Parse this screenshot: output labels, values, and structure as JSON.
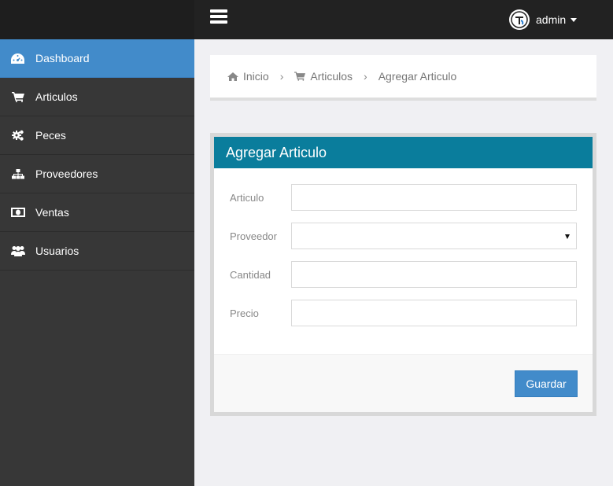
{
  "header": {
    "user_name": "admin",
    "icons": {
      "menu": "hamburger-icon",
      "avatar": "user-avatar-icon",
      "caret": "caret-down-icon"
    }
  },
  "sidebar": {
    "items": [
      {
        "label": "Dashboard",
        "icon": "dashboard-icon",
        "active": true
      },
      {
        "label": "Articulos",
        "icon": "cart-icon",
        "active": false
      },
      {
        "label": "Peces",
        "icon": "cogs-icon",
        "active": false
      },
      {
        "label": "Proveedores",
        "icon": "sitemap-icon",
        "active": false
      },
      {
        "label": "Ventas",
        "icon": "money-icon",
        "active": false
      },
      {
        "label": "Usuarios",
        "icon": "users-icon",
        "active": false
      }
    ]
  },
  "breadcrumb": {
    "home": "Inicio",
    "section": "Articulos",
    "current": "Agregar Articulo"
  },
  "form": {
    "title": "Agregar Articulo",
    "fields": {
      "articulo": {
        "label": "Articulo",
        "value": ""
      },
      "proveedor": {
        "label": "Proveedor",
        "value": ""
      },
      "cantidad": {
        "label": "Cantidad",
        "value": ""
      },
      "precio": {
        "label": "Precio",
        "value": ""
      }
    },
    "submit_label": "Guardar"
  },
  "colors": {
    "accent": "#428bca",
    "panel_heading": "#0a7d9c",
    "sidebar": "#373737",
    "topbar": "#222222"
  }
}
